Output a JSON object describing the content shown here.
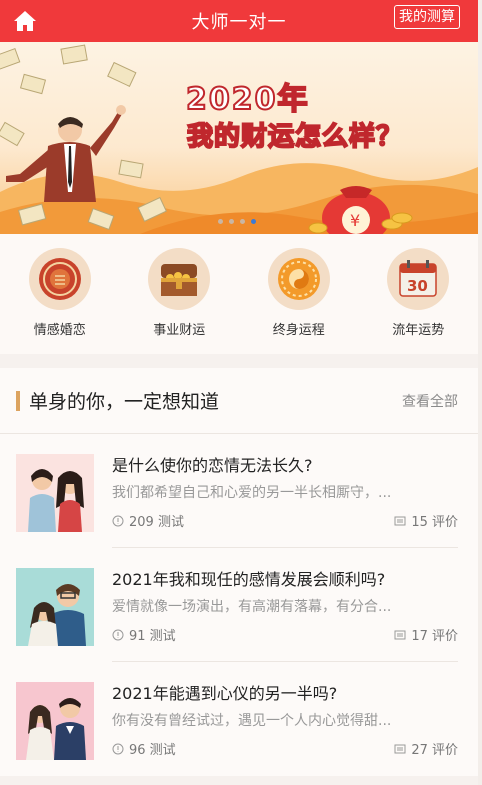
{
  "header": {
    "title": "大师一对一",
    "my_test_label": "我的测算"
  },
  "banner": {
    "line1": "2020年",
    "line2": "我的财运怎么样？",
    "coin_char": "¥",
    "slide_count": 4,
    "active_slide": 4
  },
  "categories": [
    {
      "label": "情感婚恋",
      "icon": "love-seal-icon"
    },
    {
      "label": "事业财运",
      "icon": "treasure-chest-icon"
    },
    {
      "label": "终身运程",
      "icon": "taiji-icon"
    },
    {
      "label": "流年运势",
      "icon": "calendar-icon",
      "icon_text": "30"
    }
  ],
  "section": {
    "title": "单身的你，一定想知道",
    "view_all": "查看全部"
  },
  "articles": [
    {
      "title": "是什么使你的恋情无法长久?",
      "desc": "我们都希望自己和心爱的另一半长相厮守，...",
      "tests": "209 测试",
      "reviews": "15 评价"
    },
    {
      "title": "2021年我和现任的感情发展会顺利吗?",
      "desc": "爱情就像一场演出，有高潮有落幕，有分合...",
      "tests": "91 测试",
      "reviews": "17 评价"
    },
    {
      "title": "2021年能遇到心仪的另一半吗?",
      "desc": "你有没有曾经试过，遇见一个人内心觉得甜...",
      "tests": "96 测试",
      "reviews": "27 评价"
    }
  ],
  "colors": {
    "header_red": "#f0393b",
    "accent_gold": "#dca35f",
    "active_dot": "#3c7bd6"
  }
}
